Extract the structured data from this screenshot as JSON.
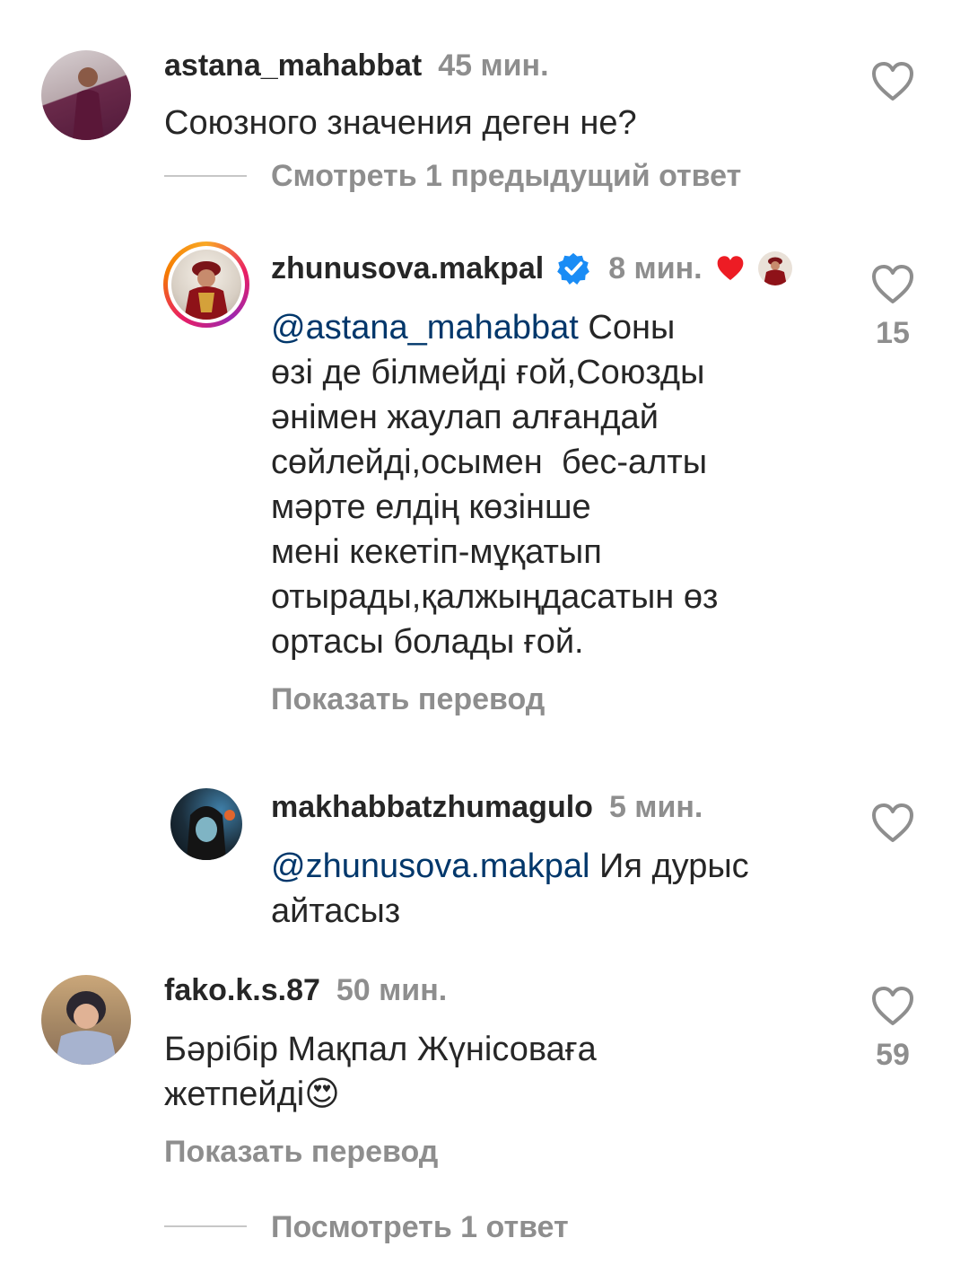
{
  "colors": {
    "text": "#262626",
    "muted": "#8e8e8e",
    "mention": "#00376b",
    "verified": "#1a8cf5",
    "heart": "#ed1c24"
  },
  "comments": [
    {
      "username": "astana_mahabbat",
      "time": "45 мин.",
      "text": "Союзного значения деген не?",
      "view_replies": "Смотреть 1 предыдущий ответ"
    },
    {
      "username": "zhunusova.makpal",
      "verified_icon": "verified-badge-icon",
      "time": "8 мин.",
      "author_liked_icon": "red-heart-icon",
      "mention": "@astana_mahabbat",
      "text_lines": [
        "Соны",
        "өзі де білмейді ғой,Союзды",
        "әнімен жаулап алғандай",
        "сөйлейді,осымен  бес-алты",
        "мәрте елдің көзінше",
        "мені кекетіп-мұқатып",
        "отырады,қалжыңдасатын өз",
        "ортасы болады ғой."
      ],
      "likes": "15",
      "translate": "Показать перевод"
    },
    {
      "username": "makhabbatzhumagulo",
      "time": "5 мин.",
      "mention": "@zhunusova.makpal",
      "text_lines": [
        "Ия дурыс",
        "айтасыз"
      ]
    },
    {
      "username": "fako.k.s.87",
      "time": "50 мин.",
      "text_lines": [
        "Бәрібір Мақпал Жүнісоваға",
        "жетпейді"
      ],
      "emoji": "😍",
      "likes": "59",
      "translate": "Показать перевод",
      "view_replies": "Посмотреть 1 ответ"
    }
  ]
}
